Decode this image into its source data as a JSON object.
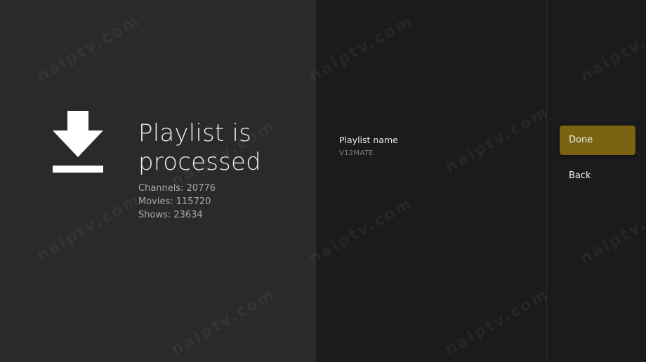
{
  "processing": {
    "icon": "download-icon",
    "title_line1": "Playlist is",
    "title_line2": "processed",
    "stats": {
      "channels": "Channels: 20776",
      "movies": "Movies: 115720",
      "shows": "Shows: 23634"
    }
  },
  "details": {
    "playlist_name_label": "Playlist name",
    "playlist_name_value": "V12MATE"
  },
  "actions": {
    "done_label": "Done",
    "back_label": "Back"
  },
  "watermark": "naiptv.com",
  "colors": {
    "accent": "#7a6210",
    "left_panel_bg": "#2a2a2a",
    "right_panel_bg": "#1b1b1b"
  }
}
